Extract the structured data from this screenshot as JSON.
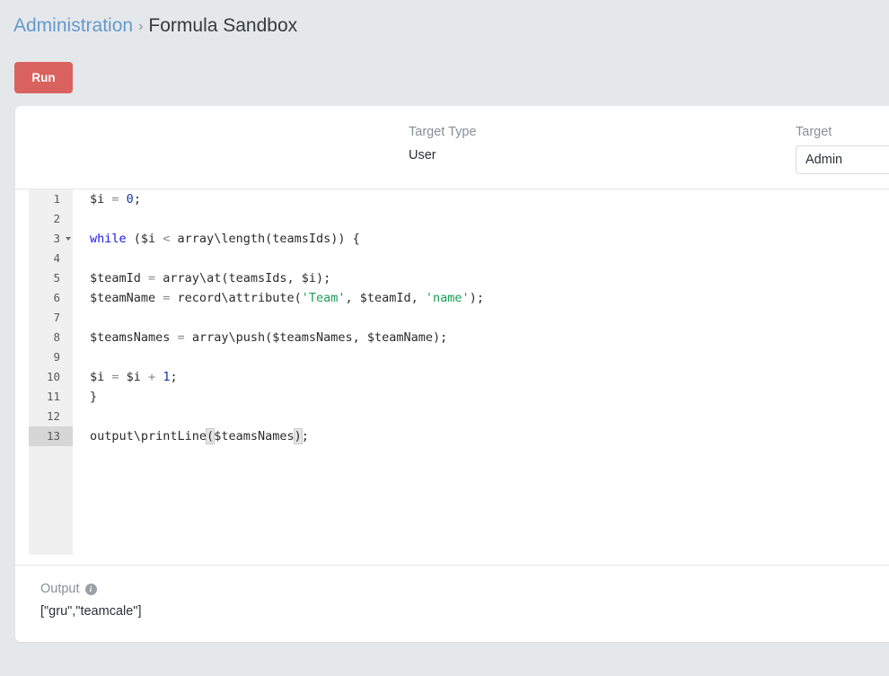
{
  "breadcrumb": {
    "parent": "Administration",
    "separator": "›",
    "current": "Formula Sandbox"
  },
  "toolbar": {
    "run_label": "Run"
  },
  "params": {
    "target_type": {
      "label": "Target Type",
      "value": "User"
    },
    "target": {
      "label": "Target",
      "value": "Admin",
      "placeholder": ""
    }
  },
  "editor": {
    "active_line": 13,
    "lines": [
      {
        "number": "1",
        "fold": false,
        "tokens": [
          {
            "t": "$i ",
            "c": "plain"
          },
          {
            "t": "=",
            "c": "op"
          },
          {
            "t": " ",
            "c": "plain"
          },
          {
            "t": "0",
            "c": "num"
          },
          {
            "t": ";",
            "c": "plain"
          }
        ]
      },
      {
        "number": "2",
        "fold": false,
        "tokens": []
      },
      {
        "number": "3",
        "fold": true,
        "tokens": [
          {
            "t": "while",
            "c": "kw"
          },
          {
            "t": " ($i ",
            "c": "plain"
          },
          {
            "t": "<",
            "c": "op"
          },
          {
            "t": " array\\length(teamsIds)) {",
            "c": "plain"
          }
        ]
      },
      {
        "number": "4",
        "fold": false,
        "tokens": []
      },
      {
        "number": "5",
        "fold": false,
        "tokens": [
          {
            "t": "$teamId ",
            "c": "plain"
          },
          {
            "t": "=",
            "c": "op"
          },
          {
            "t": " array\\at(teamsIds, $i);",
            "c": "plain"
          }
        ]
      },
      {
        "number": "6",
        "fold": false,
        "tokens": [
          {
            "t": "$teamName ",
            "c": "plain"
          },
          {
            "t": "=",
            "c": "op"
          },
          {
            "t": " record\\attribute(",
            "c": "plain"
          },
          {
            "t": "'Team'",
            "c": "str"
          },
          {
            "t": ", $teamId, ",
            "c": "plain"
          },
          {
            "t": "'name'",
            "c": "str"
          },
          {
            "t": ");",
            "c": "plain"
          }
        ]
      },
      {
        "number": "7",
        "fold": false,
        "tokens": []
      },
      {
        "number": "8",
        "fold": false,
        "tokens": [
          {
            "t": "$teamsNames ",
            "c": "plain"
          },
          {
            "t": "=",
            "c": "op"
          },
          {
            "t": " array\\push($teamsNames, $teamName);",
            "c": "plain"
          }
        ]
      },
      {
        "number": "9",
        "fold": false,
        "tokens": []
      },
      {
        "number": "10",
        "fold": false,
        "tokens": [
          {
            "t": "$i ",
            "c": "plain"
          },
          {
            "t": "=",
            "c": "op"
          },
          {
            "t": " $i ",
            "c": "plain"
          },
          {
            "t": "+",
            "c": "op"
          },
          {
            "t": " ",
            "c": "plain"
          },
          {
            "t": "1",
            "c": "num"
          },
          {
            "t": ";",
            "c": "plain"
          }
        ]
      },
      {
        "number": "11",
        "fold": false,
        "tokens": [
          {
            "t": "}",
            "c": "plain"
          }
        ]
      },
      {
        "number": "12",
        "fold": false,
        "tokens": []
      },
      {
        "number": "13",
        "fold": false,
        "tokens": [
          {
            "t": "output\\printLine",
            "c": "plain"
          },
          {
            "t": "(",
            "c": "bracket"
          },
          {
            "t": "$teamsNames",
            "c": "plain"
          },
          {
            "t": ")",
            "c": "bracket"
          },
          {
            "t": ";",
            "c": "plain"
          }
        ]
      }
    ]
  },
  "output": {
    "label": "Output",
    "info_icon": "info-icon",
    "value": "[\"gru\",\"teamcale\"]"
  },
  "colors": {
    "page_background": "#e5e8ea",
    "card_background": "#ffffff",
    "run_button": "#d9625f",
    "breadcrumb_link": "#6699cc",
    "gutter": "#f0f0f0",
    "active_gutter_line": "#d6d6d6",
    "keyword": "#1a1aee",
    "number": "#14389e",
    "string": "#18a055",
    "operator": "#888888"
  }
}
